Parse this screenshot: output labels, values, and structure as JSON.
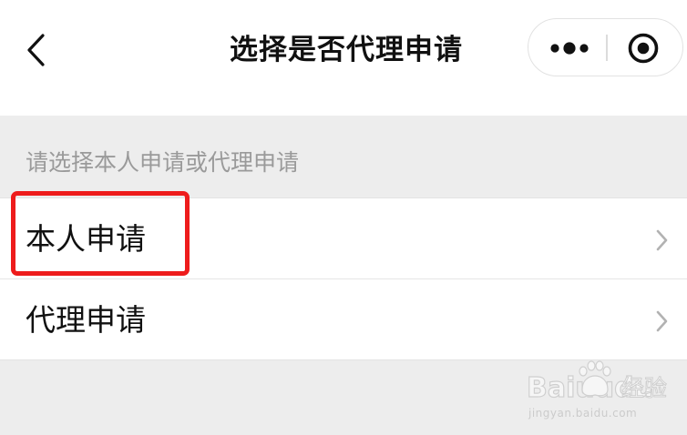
{
  "navbar": {
    "title": "选择是否代理申请",
    "back_icon": "chevron-left-icon",
    "more_icon": "more-dots-icon",
    "close_icon": "target-close-icon"
  },
  "section": {
    "hint": "请选择本人申请或代理申请"
  },
  "list": {
    "items": [
      {
        "label": "本人申请",
        "icon": "chevron-right-icon",
        "highlighted": true
      },
      {
        "label": "代理申请",
        "icon": "chevron-right-icon",
        "highlighted": false
      }
    ]
  },
  "watermark": {
    "logo": "Bai",
    "logo_tail": "du",
    "text": "经验",
    "url": "jingyan.baidu.com"
  },
  "colors": {
    "background": "#ededed",
    "surface": "#ffffff",
    "title": "#111111",
    "hint": "#9a9a9a",
    "highlight": "#ee1c1c"
  }
}
